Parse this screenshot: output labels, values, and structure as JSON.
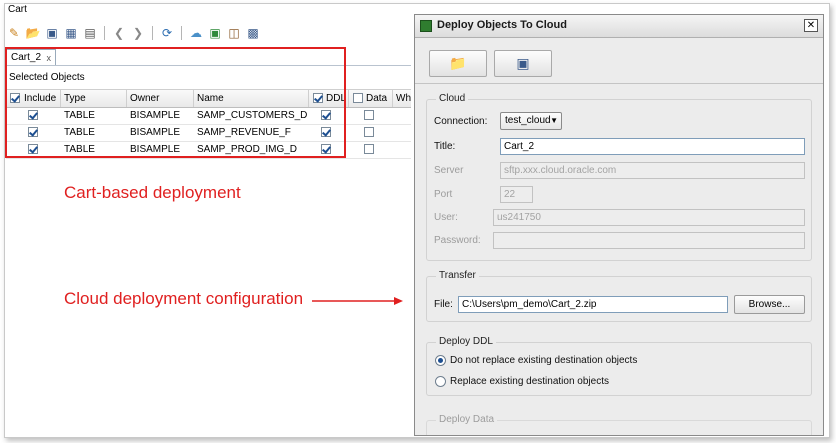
{
  "window": {
    "title": "Cart"
  },
  "toolbar": {
    "icons": [
      "new-icon",
      "open-folder-icon",
      "save-icon",
      "save-all-icon",
      "print-icon",
      "back-arrow-icon",
      "forward-arrow-icon",
      "refresh-deploy-icon",
      "cloud-icon",
      "export-icon",
      "copy-icon",
      "paste-icon"
    ]
  },
  "cart": {
    "tab_label": "Cart_2",
    "tab_close": "x",
    "selected_label": "Selected Objects",
    "columns": [
      "Include",
      "Type",
      "Owner",
      "Name",
      "DDL",
      "Data",
      "Whe"
    ],
    "rows": [
      {
        "include": true,
        "type": "TABLE",
        "owner": "BISAMPLE",
        "name": "SAMP_CUSTOMERS_D",
        "ddl": true,
        "data": false
      },
      {
        "include": true,
        "type": "TABLE",
        "owner": "BISAMPLE",
        "name": "SAMP_REVENUE_F",
        "ddl": true,
        "data": false
      },
      {
        "include": true,
        "type": "TABLE",
        "owner": "BISAMPLE",
        "name": "SAMP_PROD_IMG_D",
        "ddl": true,
        "data": false
      }
    ]
  },
  "annotations": {
    "cart_based": "Cart-based deployment",
    "cloud_config": "Cloud deployment configuration"
  },
  "colors": {
    "annotation": "#e02020",
    "accent": "#1d4f91"
  },
  "dialog": {
    "title": "Deploy Objects To Cloud",
    "close": "✕",
    "cloud": {
      "group_title": "Cloud",
      "connection_label": "Connection:",
      "connection_value": "test_cloud",
      "title_label": "Title:",
      "title_value": "Cart_2",
      "server_label": "Server",
      "server_value": "sftp.xxx.cloud.oracle.com",
      "port_label": "Port",
      "port_value": "22",
      "user_label": "User:",
      "user_value": "us241750",
      "password_label": "Password:",
      "password_value": ""
    },
    "transfer": {
      "group_title": "Transfer",
      "file_label": "File:",
      "file_value": "C:\\Users\\pm_demo\\Cart_2.zip",
      "browse_label": "Browse..."
    },
    "deploy_ddl": {
      "group_title": "Deploy DDL",
      "option1": "Do not replace existing destination objects",
      "option2": "Replace existing destination objects",
      "selected": 0
    },
    "deploy_data": {
      "group_title": "Deploy Data"
    }
  }
}
